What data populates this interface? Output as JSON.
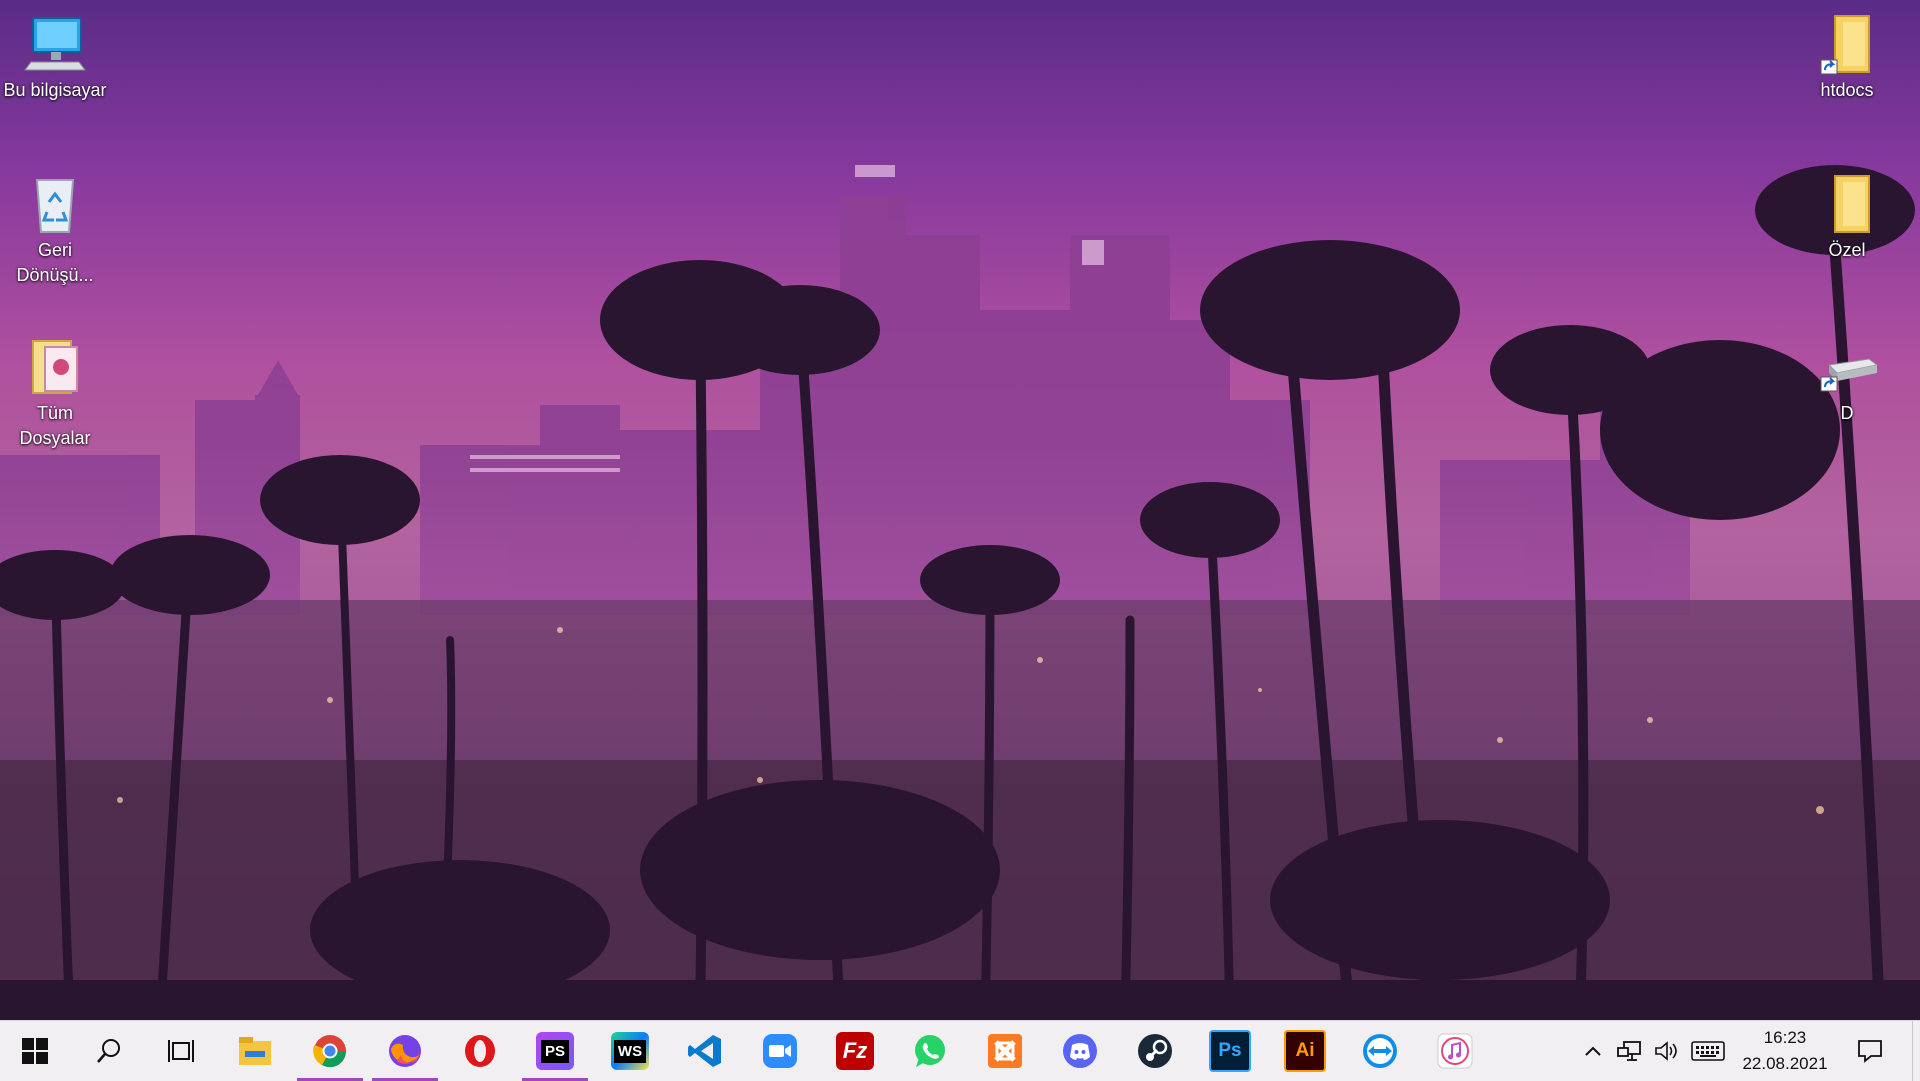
{
  "desktop": {
    "icons": [
      {
        "label": "Bu bilgisayar"
      },
      {
        "label": "Geri Dönüşü..."
      },
      {
        "label": "Tüm Dosyalar"
      },
      {
        "label": "htdocs"
      },
      {
        "label": "Özel"
      },
      {
        "label": "D"
      }
    ]
  },
  "taskbar": {
    "apps": [
      {
        "icon": "file-explorer-icon"
      },
      {
        "icon": "chrome-icon",
        "running": true
      },
      {
        "icon": "firefox-icon",
        "running": true
      },
      {
        "icon": "opera-icon"
      },
      {
        "icon": "phpstorm-icon",
        "text": "PS",
        "running": true
      },
      {
        "icon": "webstorm-icon",
        "text": "WS"
      },
      {
        "icon": "vscode-icon"
      },
      {
        "icon": "zoom-icon"
      },
      {
        "icon": "filezilla-icon",
        "text": "Fz"
      },
      {
        "icon": "whatsapp-icon"
      },
      {
        "icon": "xampp-icon"
      },
      {
        "icon": "discord-icon"
      },
      {
        "icon": "steam-icon"
      },
      {
        "icon": "photoshop-icon",
        "text": "Ps"
      },
      {
        "icon": "illustrator-icon",
        "text": "Ai"
      },
      {
        "icon": "teamviewer-icon"
      },
      {
        "icon": "itunes-icon"
      }
    ],
    "clock": {
      "time": "16:23",
      "date": "22.08.2021"
    }
  },
  "colors": {
    "accent": "#a347c1",
    "taskbar_bg": "#f1eff2"
  }
}
